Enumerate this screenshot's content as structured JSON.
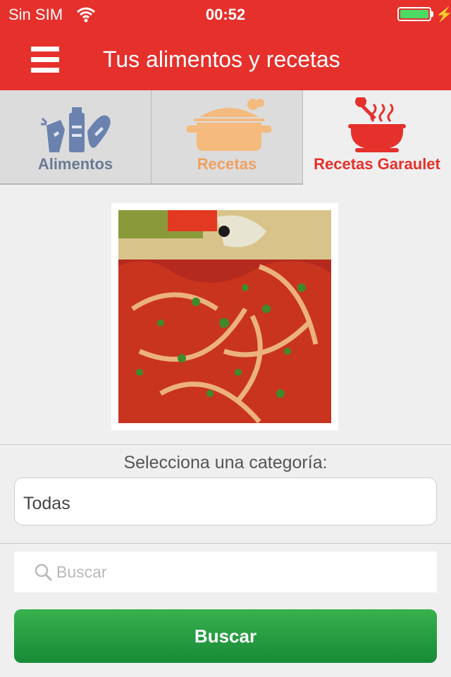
{
  "status_bar": {
    "carrier": "Sin SIM",
    "time": "00:52",
    "battery_level": 1.0,
    "charging": true
  },
  "header": {
    "title": "Tus alimentos y recetas",
    "menu_icon": "hamburger-icon",
    "color": "#e5302c"
  },
  "tabs": [
    {
      "label": "Alimentos",
      "icon": "groceries-icon",
      "color": "#6a7a95",
      "selected": false
    },
    {
      "label": "Recetas",
      "icon": "cooking-pot-icon",
      "color": "#f0a060",
      "selected": false
    },
    {
      "label": "Recetas Garaulet",
      "icon": "soup-bowl-icon",
      "color": "#e5302c",
      "selected": true
    }
  ],
  "category": {
    "label": "Selecciona una categoría:",
    "value": "Todas"
  },
  "search": {
    "placeholder": "Buscar",
    "value": ""
  },
  "search_button": {
    "label": "Buscar",
    "color": "#2a9d45"
  }
}
